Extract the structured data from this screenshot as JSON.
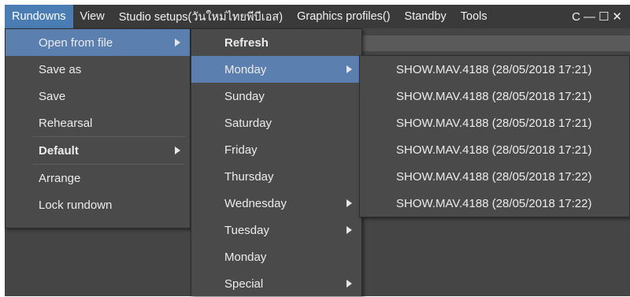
{
  "menubar": {
    "items": [
      {
        "label": "Rundowns",
        "active": true
      },
      {
        "label": "View"
      },
      {
        "label": "Studio setups(วันใหม่ไทยพีบีเอส)"
      },
      {
        "label": "Graphics profiles()"
      },
      {
        "label": "Standby"
      },
      {
        "label": "Tools"
      },
      {
        "label": "C"
      }
    ],
    "minimize_glyph": "—",
    "maximize_glyph": "☐",
    "close_glyph": "✕"
  },
  "rundowns_menu": {
    "items": [
      {
        "label": "Open from file",
        "has_submenu": true,
        "highlighted": true
      },
      {
        "label": "Save as"
      },
      {
        "label": "Save"
      },
      {
        "label": "Rehearsal"
      },
      {
        "label": "Default",
        "bold": true,
        "has_submenu": true
      },
      {
        "label": "Arrange"
      },
      {
        "label": "Lock rundown"
      }
    ]
  },
  "open_from_file_menu": {
    "items": [
      {
        "label": "Refresh",
        "bold": true
      },
      {
        "label": "Monday",
        "has_submenu": true,
        "highlighted": true
      },
      {
        "label": "Sunday"
      },
      {
        "label": "Saturday"
      },
      {
        "label": "Friday"
      },
      {
        "label": "Thursday"
      },
      {
        "label": "Wednesday",
        "has_submenu": true
      },
      {
        "label": "Tuesday",
        "has_submenu": true
      },
      {
        "label": "Monday"
      },
      {
        "label": "Special",
        "has_submenu": true
      }
    ]
  },
  "monday_menu": {
    "items": [
      {
        "label": "SHOW.MAV.4188 (28/05/2018 17:21)"
      },
      {
        "label": "SHOW.MAV.4188 (28/05/2018 17:21)"
      },
      {
        "label": "SHOW.MAV.4188 (28/05/2018 17:21)"
      },
      {
        "label": "SHOW.MAV.4188 (28/05/2018 17:21)"
      },
      {
        "label": "SHOW.MAV.4188 (28/05/2018 17:22)"
      },
      {
        "label": "SHOW.MAV.4188 (28/05/2018 17:22)"
      }
    ]
  },
  "colors": {
    "menubar_bg": "#3a3a3a",
    "menu_bg": "#4a4a4a",
    "highlight": "#5b7fae",
    "active_menu": "#4a7db4"
  }
}
